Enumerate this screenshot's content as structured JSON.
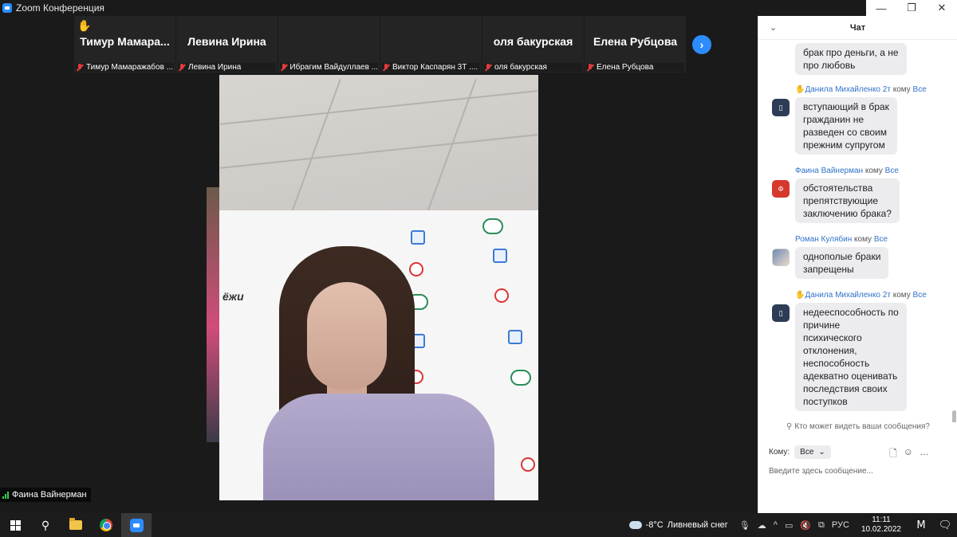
{
  "window": {
    "title": "Zoom Конференция"
  },
  "participants": [
    {
      "display": "Тимур  Мамара...",
      "caption": "Тимур Мамаражабов ...",
      "type": "name",
      "hand_raised": true
    },
    {
      "display": "Левина Ирина",
      "caption": "Левина Ирина",
      "type": "name",
      "hand_raised": false
    },
    {
      "display": "",
      "caption": "Ибрагим Вайдуллаев ...",
      "type": "video-person",
      "hand_raised": false
    },
    {
      "display": "",
      "caption": "Виктор Каспарян 3Т ....",
      "type": "video-wall",
      "hand_raised": false
    },
    {
      "display": "оля бакурская",
      "caption": "оля бакурская",
      "type": "name",
      "hand_raised": false
    },
    {
      "display": "Елена Рубцова",
      "caption": "Елена Рубцова",
      "type": "name",
      "hand_raised": false
    }
  ],
  "speaker": {
    "name": "Фаина Вайнерман",
    "watermark": "ёжи"
  },
  "chat": {
    "title": "Чат",
    "to_word": "кому",
    "messages": [
      {
        "sender": "",
        "text_lines": [
          "брак про деньги, а не",
          "про любовь"
        ],
        "avatar": ""
      },
      {
        "sender": "Данила Михайленко 2т",
        "recipient": "Все",
        "text_lines": [
          "вступающий в брак",
          "гражданин не",
          "разведен со своим",
          "прежним супругом"
        ],
        "avatar": "▯"
      },
      {
        "sender": "Фаина Вайнерман",
        "recipient": "Все",
        "text_lines": [
          "обстоятельства",
          "препятствующие",
          "заключению брака?"
        ],
        "avatar": "Ф"
      },
      {
        "sender": "Роман Кулябин",
        "recipient": "Все",
        "text_lines": [
          "однополые браки",
          "запрещены"
        ],
        "avatar": ""
      },
      {
        "sender": "Данила Михайленко 2т",
        "recipient": "Все",
        "text_lines": [
          "недееспособность по",
          "причине",
          "психического",
          "отклонения,",
          "неспособность",
          "адекватно оценивать",
          "последствия своих",
          "поступков"
        ],
        "avatar": "▯"
      }
    ],
    "privacy_text": "Кто может видеть ваши сообщения?",
    "to_label": "Кому:",
    "to_value": "Все",
    "input_placeholder": "Введите здесь сообщение..."
  },
  "taskbar": {
    "weather_temp": "-8°C",
    "weather_text": "Ливневый снег",
    "language": "РУС",
    "time": "11:11",
    "date": "10.02.2022"
  },
  "colors": {
    "accent": "#2d8cff",
    "chat_link": "#3272c9",
    "muted": "#e23b3b"
  }
}
